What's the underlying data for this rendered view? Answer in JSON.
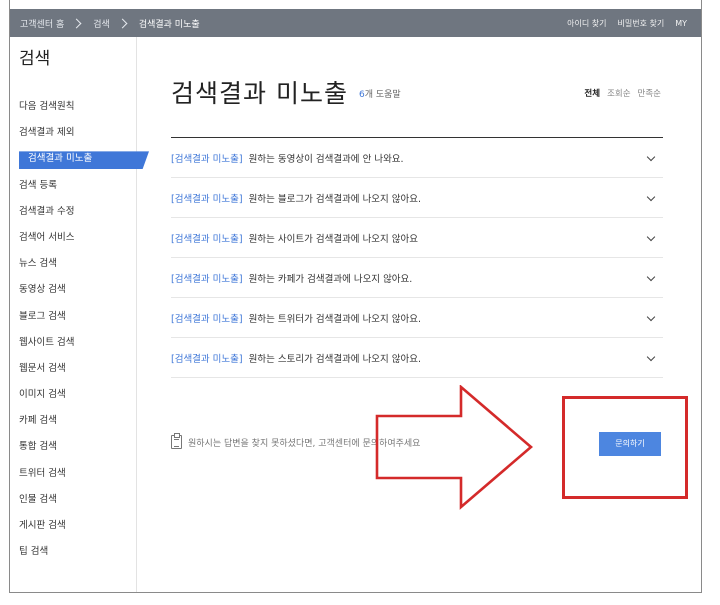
{
  "breadcrumb": {
    "home": "고객센터 홈",
    "level1": "검색",
    "current": "검색결과 미노출"
  },
  "top_links": [
    "아이디 찾기",
    "비밀번호 찾기",
    "MY"
  ],
  "sidebar": {
    "title": "검색",
    "items": [
      {
        "label": "다음 검색원칙"
      },
      {
        "label": "검색결과 제외"
      },
      {
        "label": "검색결과 미노출",
        "active": true
      },
      {
        "label": "검색 등록"
      },
      {
        "label": "검색결과 수정"
      },
      {
        "label": "검색어 서비스"
      },
      {
        "label": "뉴스 검색"
      },
      {
        "label": "동영상 검색"
      },
      {
        "label": "블로그 검색"
      },
      {
        "label": "웹사이트 검색"
      },
      {
        "label": "웹문서 검색"
      },
      {
        "label": "이미지 검색"
      },
      {
        "label": "카페 검색"
      },
      {
        "label": "통합 검색"
      },
      {
        "label": "트위터 검색"
      },
      {
        "label": "인물 검색"
      },
      {
        "label": "게시판 검색"
      },
      {
        "label": "팁 검색"
      }
    ]
  },
  "main": {
    "title": "검색결과 미노출",
    "count_num": "6",
    "count_text": "개 도움말",
    "sort_options": [
      {
        "label": "전체",
        "active": true
      },
      {
        "label": "조회순"
      },
      {
        "label": "만족순"
      }
    ],
    "faq": [
      {
        "category": "[검색결과 미노출]",
        "question": "원하는 동영상이 검색결과에 안 나와요."
      },
      {
        "category": "[검색결과 미노출]",
        "question": "원하는 블로그가 검색결과에 나오지 않아요."
      },
      {
        "category": "[검색결과 미노출]",
        "question": "원하는 사이트가 검색결과에 나오지 않아요"
      },
      {
        "category": "[검색결과 미노출]",
        "question": "원하는 카페가 검색결과에 나오지 않아요."
      },
      {
        "category": "[검색결과 미노출]",
        "question": "원하는 트위터가 검색결과에 나오지 않아요."
      },
      {
        "category": "[검색결과 미노출]",
        "question": "원하는 스토리가 검색결과에 나오지 않아요."
      }
    ],
    "help_text": "원하시는 답변을 찾지 못하셨다면, 고객센터에 문의하여주세요",
    "inquiry_button": "문의하기"
  },
  "colors": {
    "accent": "#3f77d8",
    "topbar": "#6f7680",
    "annotation_red": "#d42a2a"
  }
}
